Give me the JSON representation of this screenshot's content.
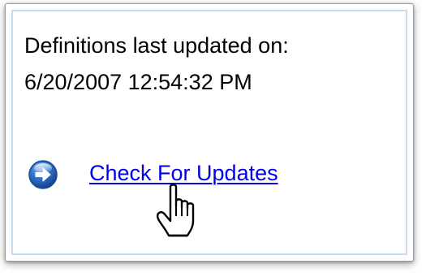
{
  "panel": {
    "definitions_label": "Definitions last updated on:",
    "definitions_timestamp": "6/20/2007 12:54:32 PM",
    "check_updates_link": "Check For Updates"
  },
  "icons": {
    "link_icon": "arrow-right-circle-icon",
    "cursor": "hand-pointer-cursor"
  },
  "colors": {
    "link": "#0000ee",
    "panel_inner_border": "#c8dcee",
    "icon_blue": "#1f5fb5"
  }
}
